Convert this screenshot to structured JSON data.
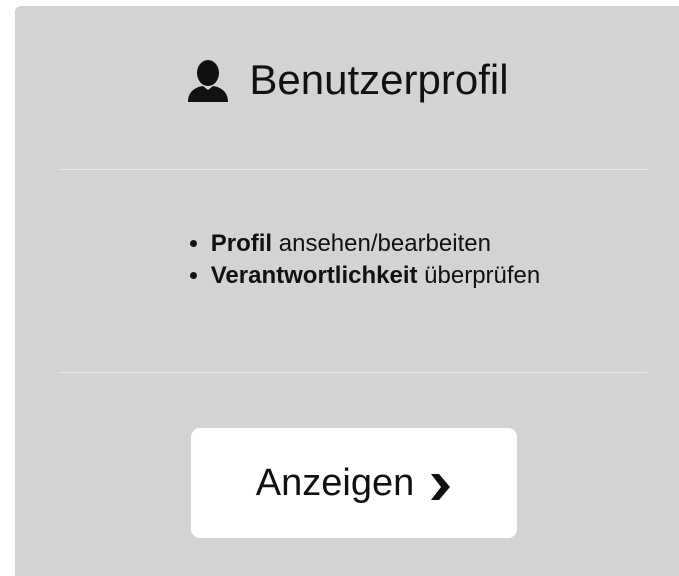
{
  "card": {
    "title": "Benutzerprofil",
    "icon": "user-icon",
    "features": [
      {
        "bold": "Profil",
        "text": "ansehen/bearbeiten"
      },
      {
        "bold": "Verantwortlichkeit",
        "text": "überprüfen"
      }
    ],
    "button": {
      "label": "Anzeigen",
      "icon": "chevron-right-icon"
    }
  },
  "colors": {
    "panel_background": "#d3d3d3",
    "button_background": "#ffffff",
    "text": "#111111",
    "divider": "#e9e9e9"
  }
}
